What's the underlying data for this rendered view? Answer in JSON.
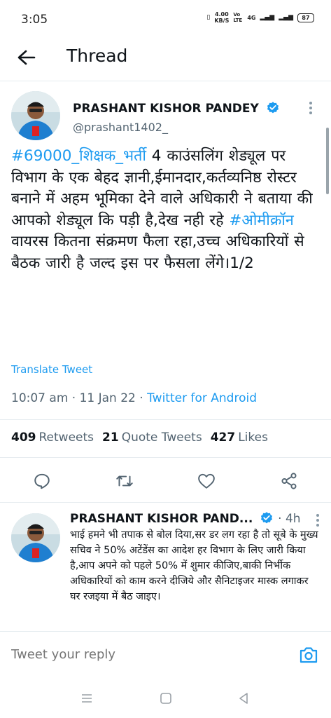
{
  "status": {
    "time": "3:05",
    "speed_value": "4.00",
    "speed_unit": "KB/S",
    "volte": "Vo LTE",
    "network": "4G",
    "battery": "87"
  },
  "header": {
    "title": "Thread"
  },
  "tweet": {
    "author_name": "PRASHANT KISHOR PANDEY",
    "handle": "@prashant1402_",
    "text_hashtag1": "#69000_शिक्षक_भर्ती",
    "text_part1": " 4 काउंसलिंग शेड्यूल पर विभाग के एक बेहद ज्ञानी,ईमानदार,कर्तव्यनिष्ठ रोस्टर बनाने में अहम भूमिका देने वाले अधिकारी ने बताया की आपको शेड्यूल कि पड़ी है,देख नही रहे ",
    "text_hashtag2": "#ओमीक्रॉन",
    "text_part2": " वायरस कितना संक्रमण फैला रहा,उच्च अधिकारियों से बैठक जारी है जल्द इस पर फैसला लेंगे।1/2",
    "translate_label": "Translate Tweet",
    "time": "10:07 am",
    "date": "11 Jan 22",
    "source": "Twitter for Android",
    "retweets_count": "409",
    "retweets_label": "Retweets",
    "quotes_count": "21",
    "quotes_label": "Quote Tweets",
    "likes_count": "427",
    "likes_label": "Likes"
  },
  "reply": {
    "author_name": "PRASHANT KISHOR PAND...",
    "time_ago": "4h",
    "text": "भाई हमने भी तपाक से बोल दिया,सर डर लग रहा है तो सूबे के मुख्य सचिव ने 50% अटेंडेंस का आदेश हर विभाग के लिए जारी किया है,आप अपने को पहले 50% में शुमार कीजिए,बाकी निर्भीक अधिकारियों को काम करने दीजिये और सैनिटाइजर मास्क लगाकर घर रजइया में बैठ जाइए।"
  },
  "composer": {
    "placeholder": "Tweet your reply"
  },
  "colors": {
    "accent": "#1d9bf0",
    "text": "#0f1419",
    "secondary": "#536471",
    "divider": "#e6ecf0"
  },
  "icons": [
    "back-arrow-icon",
    "verified-badge-icon",
    "more-vertical-icon",
    "reply-icon",
    "retweet-icon",
    "like-icon",
    "share-icon",
    "camera-icon",
    "menu-icon",
    "home-icon",
    "back-nav-icon"
  ]
}
